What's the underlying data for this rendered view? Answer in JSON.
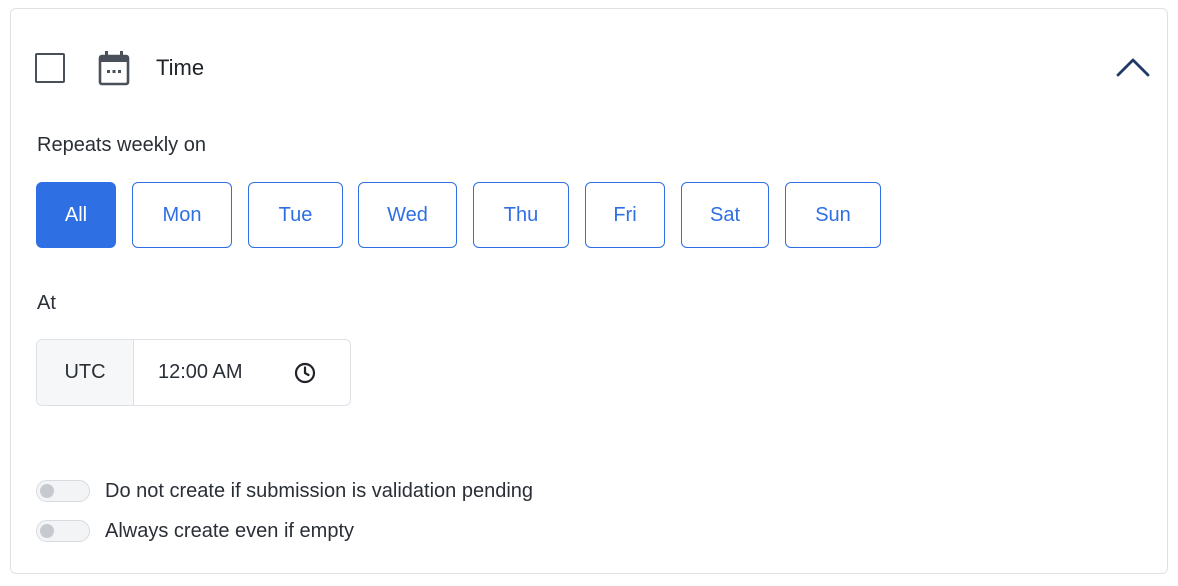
{
  "section": {
    "title": "Time",
    "checked": false,
    "expanded": true
  },
  "schedule": {
    "repeats_label": "Repeats weekly on",
    "days": [
      {
        "label": "All",
        "selected": true
      },
      {
        "label": "Mon",
        "selected": false
      },
      {
        "label": "Tue",
        "selected": false
      },
      {
        "label": "Wed",
        "selected": false
      },
      {
        "label": "Thu",
        "selected": false
      },
      {
        "label": "Fri",
        "selected": false
      },
      {
        "label": "Sat",
        "selected": false
      },
      {
        "label": "Sun",
        "selected": false
      }
    ],
    "at_label": "At",
    "timezone": "UTC",
    "time": "12:00 AM"
  },
  "options": [
    {
      "label": "Do not create if submission is validation pending",
      "enabled": false
    },
    {
      "label": "Always create even if empty",
      "enabled": false
    }
  ],
  "icons": {
    "calendar": "calendar-icon",
    "chevron": "chevron-up-icon",
    "clock": "clock-icon"
  },
  "colors": {
    "accent": "#2f6fe4",
    "border": "#dde1e6",
    "text": "#2a2f36"
  }
}
